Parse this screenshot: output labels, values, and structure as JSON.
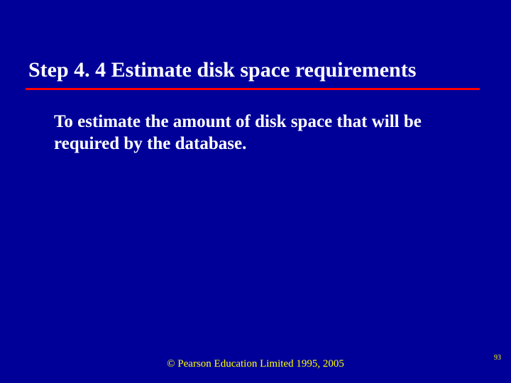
{
  "slide": {
    "title": "Step 4. 4  Estimate disk space requirements",
    "body": "To estimate the amount of disk space that will be required by the database.",
    "footer": "© Pearson Education Limited 1995, 2005",
    "page_number": "93"
  }
}
